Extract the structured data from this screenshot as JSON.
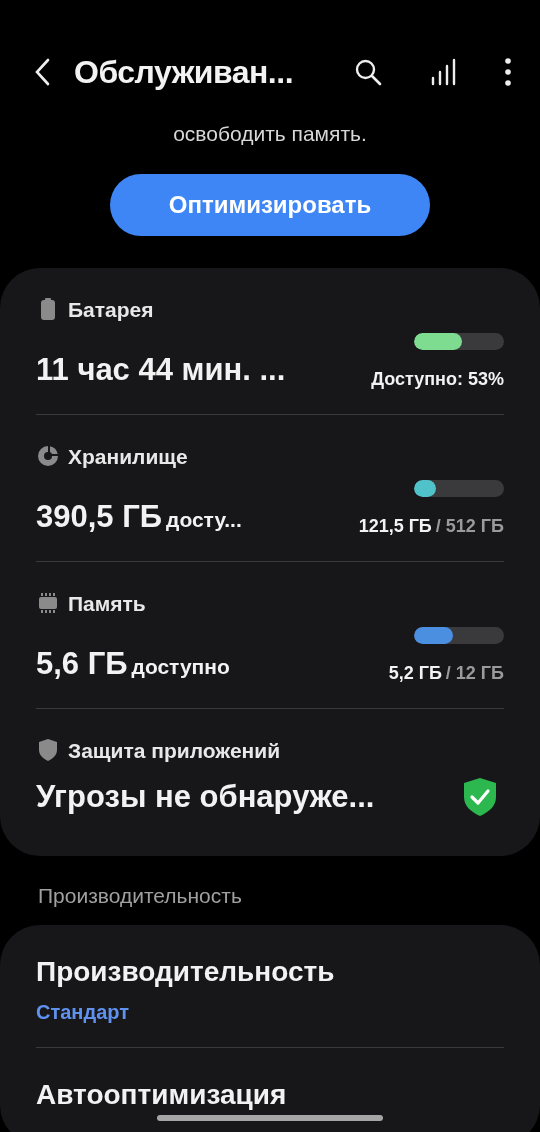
{
  "header": {
    "title": "Обслуживан..."
  },
  "intro": "освободить память.",
  "optimize_button": "Оптимизировать",
  "status_items": [
    {
      "kind": "meter",
      "label": "Батарея",
      "value": "11 час 44 мин. ...",
      "reading": "Доступно: 53%",
      "level": 0.53,
      "color": "#7ddc8f"
    },
    {
      "kind": "meter",
      "label": "Хранилище",
      "value": "390,5 ГБ",
      "value_suffix": "досту...",
      "reading": "121,5 ГБ",
      "reading_total": "/ 512 ГБ",
      "level": 0.24,
      "color": "#4fc3c9"
    },
    {
      "kind": "meter",
      "label": "Память",
      "value": "5,6 ГБ",
      "value_suffix": "доступно",
      "reading": "5,2 ГБ",
      "reading_total": "/ 12 ГБ",
      "level": 0.43,
      "color": "#4a8fe0"
    },
    {
      "kind": "status",
      "label": "Защита приложений",
      "value": "Угрозы не обнаруже...",
      "ok": true
    }
  ],
  "section_title": "Производительность",
  "settings": [
    {
      "title": "Производительность",
      "subtitle": "Стандарт"
    },
    {
      "title": "Автооптимизация"
    }
  ]
}
